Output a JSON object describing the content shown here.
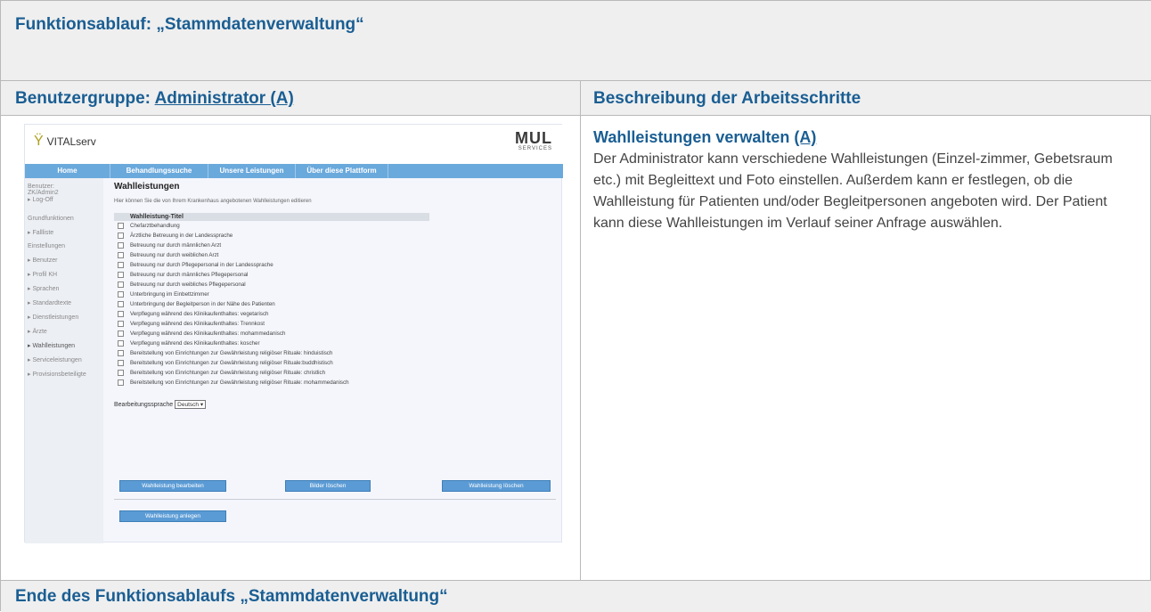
{
  "title": "Funktionsablauf: „Stammdatenverwaltung“",
  "header": {
    "left_prefix": "Benutzergruppe: ",
    "left_link": "Administrator (A)",
    "right": "Beschreibung der Arbeitsschritte"
  },
  "description": {
    "heading": "Wahlleistungen verwalten ",
    "heading_link": "(A)",
    "text": "Der Administrator kann verschiedene Wahlleistungen (Einzel-zimmer, Gebetsraum etc.) mit Begleittext und Foto einstellen. Außerdem kann er festlegen, ob die Wahlleistung für Patienten und/oder Begleitpersonen angeboten wird. Der Patient kann diese Wahlleistungen im Verlauf seiner Anfrage auswählen."
  },
  "footer": "Ende des Funktionsablaufs „Stammdatenverwaltung“",
  "screenshot": {
    "logo": "VITALserv",
    "brand_big": "MUL",
    "brand_small": "SERVICES",
    "nav": [
      "Home",
      "Behandlungssuche",
      "Unsere Leistungen",
      "Über diese Plattform"
    ],
    "sidebar": [
      "Benutzer:",
      "ZK/Admin2",
      "▸ Log-Off",
      "",
      "Grundfunktionen",
      "▸ Fallliste",
      "Einstellungen",
      "▸ Benutzer",
      "▸ Profil KH",
      "▸ Sprachen",
      "▸ Standardtexte",
      "▸ Dienstleistungen",
      "▸ Ärzte",
      "▸ Wahlleistungen",
      "▸ Serviceleistungen",
      "▸ Provisionsbeteiligte"
    ],
    "page_title": "Wahlleistungen",
    "page_subtitle": "Hier können Sie die von Ihrem Krankenhaus angebotenen Wahlleistungen editieren",
    "column_header": "Wahlleistung-Titel",
    "items": [
      "Chefarztbehandlung",
      "Ärztliche Betreuung in der Landessprache",
      "Betreuung nur durch männlichen Arzt",
      "Betreuung nur durch weiblichen Arzt",
      "Betreuung nur durch Pflegepersonal in der Landessprache",
      "Betreuung nur durch männliches Pflegepersonal",
      "Betreuung nur durch weibliches Pflegepersonal",
      "Unterbringung im Einbettzimmer",
      "Unterbringung der Begleitperson in der Nähe des Patienten",
      "Verpflegung während des Klinikaufenthaltes: vegetarisch",
      "Verpflegung während des Klinikaufenthaltes: Trennkost",
      "Verpflegung während des Klinikaufenthaltes: mohammedanisch",
      "Verpflegung während des Klinikaufenthaltes: koscher",
      "Bereitstellung von Einrichtungen zur Gewährleistung religiöser Rituale: hinduistisch",
      "Bereitstellung von Einrichtungen zur Gewährleistung religiöser Rituale:buddhistisch",
      "Bereitstellung von Einrichtungen zur Gewährleistung religiöser Rituale: christlich",
      "Bereitstellung von Einrichtungen zur Gewährleistung religiöser Rituale: mohammedanisch"
    ],
    "language_label": "Bearbeitungssprache",
    "language_value": "Deutsch",
    "btn_edit": "Wahlleistung bearbeiten",
    "btn_delete_images": "Bilder löschen",
    "btn_delete": "Wahlleistung löschen",
    "btn_create": "Wahlleistung anlegen"
  }
}
